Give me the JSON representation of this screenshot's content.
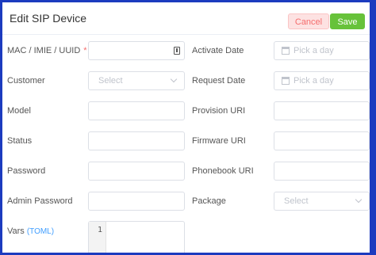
{
  "dialog": {
    "title": "Edit SIP Device",
    "cancel_label": "Cancel",
    "save_label": "Save"
  },
  "fields": {
    "mac": {
      "label": "MAC / IMIE / UUID",
      "required_mark": "*"
    },
    "activate_date": {
      "label": "Activate Date",
      "placeholder": "Pick a day"
    },
    "customer": {
      "label": "Customer",
      "placeholder": "Select"
    },
    "request_date": {
      "label": "Request Date",
      "placeholder": "Pick a day"
    },
    "model": {
      "label": "Model"
    },
    "provision_uri": {
      "label": "Provision URI"
    },
    "status": {
      "label": "Status"
    },
    "firmware_uri": {
      "label": "Firmware URI"
    },
    "password": {
      "label": "Password"
    },
    "phonebook_uri": {
      "label": "Phonebook URI"
    },
    "admin_password": {
      "label": "Admin Password"
    },
    "package": {
      "label": "Package",
      "placeholder": "Select"
    },
    "vars": {
      "label": "Vars",
      "link": "(TOML)",
      "line_number": "1"
    }
  },
  "icons": {
    "mac": "id-card-icon",
    "calendar": "calendar-icon",
    "select": "chevron-down-icon"
  }
}
